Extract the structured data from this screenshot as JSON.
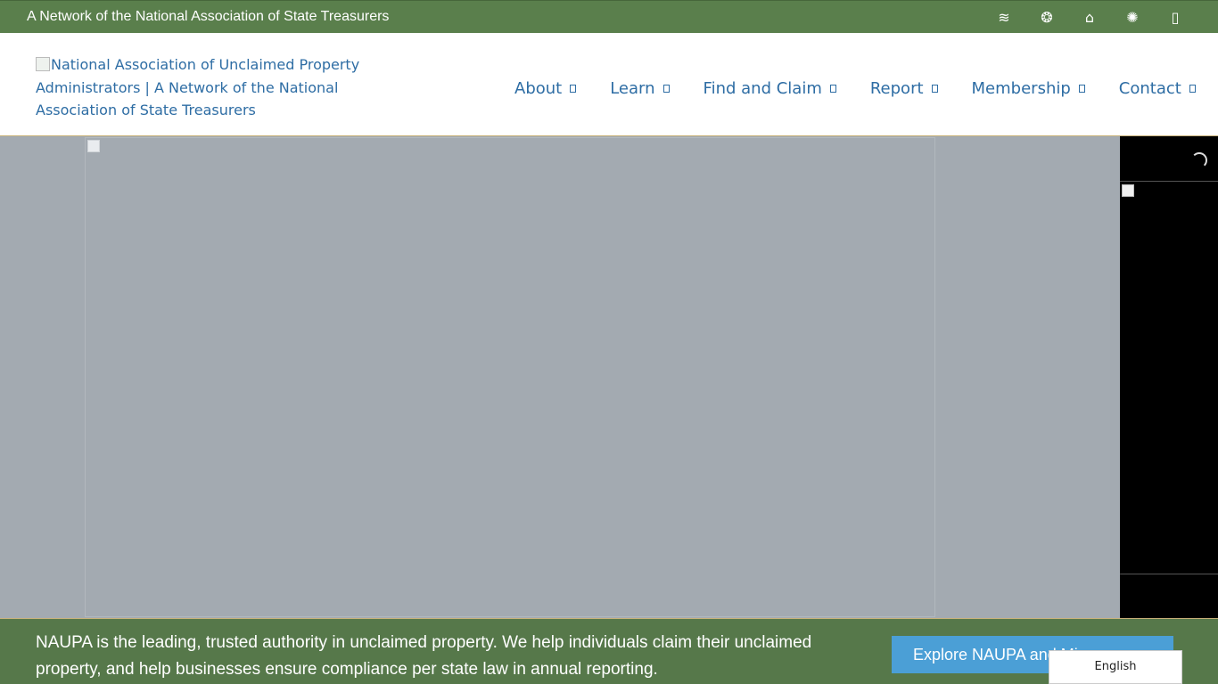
{
  "topbar": {
    "network_text": "A Network of the National Association of State Treasurers",
    "icons": [
      {
        "name": "waves-icon",
        "glyph": "≋"
      },
      {
        "name": "sos-logo-icon",
        "glyph": "❂"
      },
      {
        "name": "capitol-icon",
        "glyph": "⌂"
      },
      {
        "name": "bird-icon",
        "glyph": "✺"
      },
      {
        "name": "square-icon",
        "glyph": "▯"
      }
    ]
  },
  "header": {
    "logo_alt": "National Association of Unclaimed Property Administrators | A Network of the National Association of State Treasurers"
  },
  "nav": {
    "items": [
      "About",
      "Learn",
      "Find and Claim",
      "Report",
      "Membership",
      "Contact"
    ]
  },
  "banner": {
    "text": "NAUPA is the leading, trusted authority in unclaimed property.  We help individuals claim their unclaimed property, and help businesses ensure compliance per state law in annual reporting.",
    "explore_label": "Explore NAUPA and Mi"
  },
  "language": {
    "selected": "English"
  },
  "colors": {
    "topbar_green": "#5a7f4c",
    "link_blue": "#2e6da4",
    "button_blue": "#4b9fd6",
    "hero_gray": "#a3aab1"
  }
}
